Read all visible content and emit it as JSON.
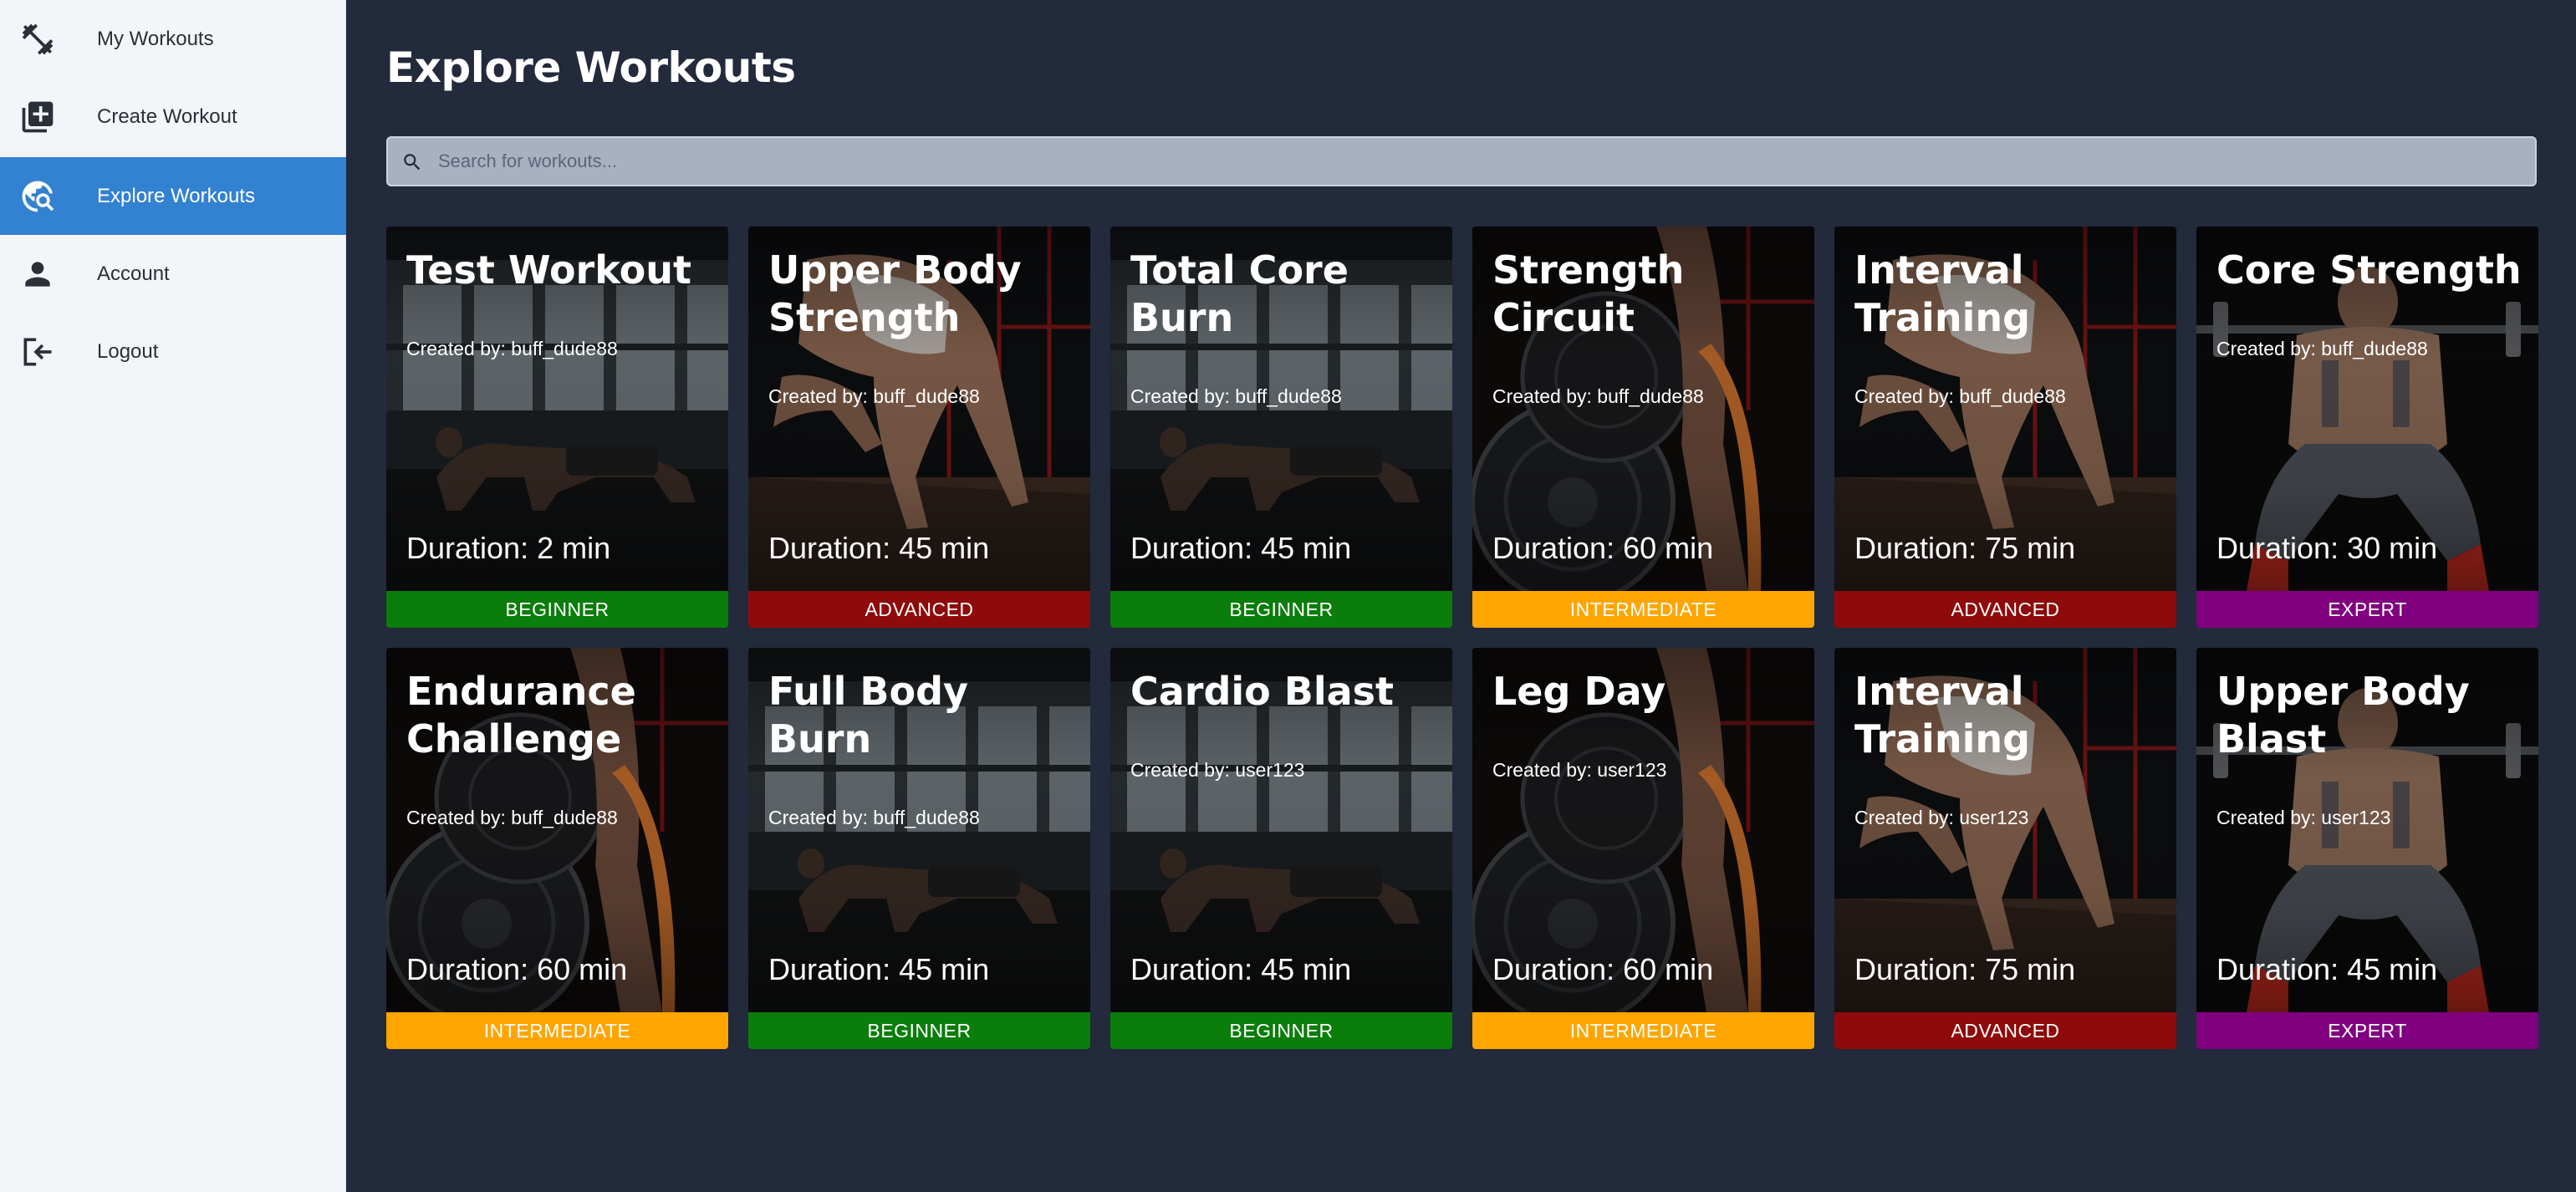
{
  "sidebar": {
    "items": [
      {
        "label": "My Workouts",
        "icon": "dumbbell-icon",
        "active": false
      },
      {
        "label": "Create Workout",
        "icon": "add-box-icon",
        "active": false
      },
      {
        "label": "Explore Workouts",
        "icon": "travel-explore-icon",
        "active": true
      },
      {
        "label": "Account",
        "icon": "person-icon",
        "active": false
      },
      {
        "label": "Logout",
        "icon": "logout-icon",
        "active": false
      }
    ]
  },
  "main": {
    "title": "Explore Workouts",
    "search": {
      "placeholder": "Search for workouts..."
    }
  },
  "level_colors": {
    "BEGINNER": "#0a7d0a",
    "ADVANCED": "#8f0a0a",
    "INTERMEDIATE": "#ffa500",
    "EXPERT": "#800080"
  },
  "workouts": [
    {
      "title": "Test Workout",
      "creator": "Created by: buff_dude88",
      "duration": "Duration: 2 min",
      "level": "BEGINNER",
      "image": "plank-photo"
    },
    {
      "title": "Upper Body Strength",
      "creator": "Created by: buff_dude88",
      "duration": "Duration: 45 min",
      "level": "ADVANCED",
      "image": "lunge-photo"
    },
    {
      "title": "Total Core Burn",
      "creator": "Created by: buff_dude88",
      "duration": "Duration: 45 min",
      "level": "BEGINNER",
      "image": "plank-photo"
    },
    {
      "title": "Strength Circuit",
      "creator": "Created by: buff_dude88",
      "duration": "Duration: 60 min",
      "level": "INTERMEDIATE",
      "image": "weight-plate-photo"
    },
    {
      "title": "Interval Training",
      "creator": "Created by: buff_dude88",
      "duration": "Duration: 75 min",
      "level": "ADVANCED",
      "image": "lunge-photo"
    },
    {
      "title": "Core Strength",
      "creator": "Created by: buff_dude88",
      "duration": "Duration: 30 min",
      "level": "EXPERT",
      "image": "squat-photo"
    },
    {
      "title": "Endurance Challenge",
      "creator": "Created by: buff_dude88",
      "duration": "Duration: 60 min",
      "level": "INTERMEDIATE",
      "image": "weight-plate-photo"
    },
    {
      "title": "Full Body Burn",
      "creator": "Created by: buff_dude88",
      "duration": "Duration: 45 min",
      "level": "BEGINNER",
      "image": "plank-photo"
    },
    {
      "title": "Cardio Blast",
      "creator": "Created by: user123",
      "duration": "Duration: 45 min",
      "level": "BEGINNER",
      "image": "plank-photo"
    },
    {
      "title": "Leg Day",
      "creator": "Created by: user123",
      "duration": "Duration: 60 min",
      "level": "INTERMEDIATE",
      "image": "weight-plate-photo"
    },
    {
      "title": "Interval Training",
      "creator": "Created by: user123",
      "duration": "Duration: 75 min",
      "level": "ADVANCED",
      "image": "lunge-photo"
    },
    {
      "title": "Upper Body Blast",
      "creator": "Created by: user123",
      "duration": "Duration: 45 min",
      "level": "EXPERT",
      "image": "squat-photo"
    }
  ]
}
